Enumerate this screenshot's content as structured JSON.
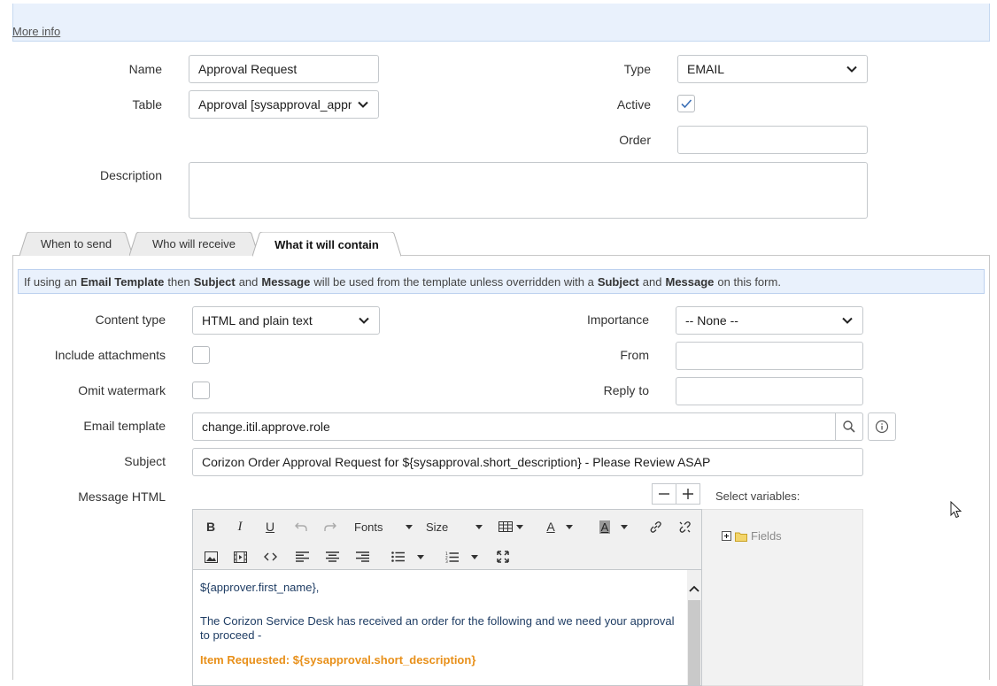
{
  "banner": {
    "more_info": "More info"
  },
  "form": {
    "name": {
      "label": "Name",
      "value": "Approval Request"
    },
    "table": {
      "label": "Table",
      "value": "Approval [sysapproval_approver]"
    },
    "type": {
      "label": "Type",
      "value": "EMAIL"
    },
    "active": {
      "label": "Active",
      "checked": true
    },
    "order": {
      "label": "Order",
      "value": ""
    },
    "description": {
      "label": "Description",
      "value": ""
    }
  },
  "tabs": [
    {
      "label": "When to send"
    },
    {
      "label": "Who will receive"
    },
    {
      "label": "What it will contain",
      "active": true
    }
  ],
  "notice": {
    "p1": "If using an",
    "b1": "Email Template",
    "p2": "then",
    "b2": "Subject",
    "p3": "and",
    "b3": "Message",
    "p4": "will be used from the template unless overridden with a",
    "b4": "Subject",
    "p5": "and",
    "b5": "Message",
    "p6": "on this form."
  },
  "contain": {
    "content_type": {
      "label": "Content type",
      "value": "HTML and plain text"
    },
    "importance": {
      "label": "Importance",
      "value": "-- None --"
    },
    "include_attachments": {
      "label": "Include attachments",
      "checked": false
    },
    "from": {
      "label": "From",
      "value": ""
    },
    "omit_watermark": {
      "label": "Omit watermark",
      "checked": false
    },
    "reply_to": {
      "label": "Reply to",
      "value": ""
    },
    "email_template": {
      "label": "Email template",
      "value": "change.itil.approve.role"
    },
    "subject": {
      "label": "Subject",
      "value": "Corizon Order Approval Request for ${sysapproval.short_description} - Please Review ASAP"
    },
    "message_html": {
      "label": "Message HTML"
    },
    "select_variables": "Select variables:"
  },
  "editor": {
    "toolbar": {
      "fonts": "Fonts",
      "size": "Size"
    },
    "content": {
      "line1": "${approver.first_name},",
      "line2": "The Corizon Service Desk has received an order for the following and we need your approval to proceed -",
      "line3": "Item Requested: ${sysapproval.short_description}"
    }
  },
  "tree": {
    "fields": "Fields"
  },
  "colors": {
    "accent": "#3b6fb6",
    "banner_bg": "#e9f1fc",
    "orange": "#e8901a"
  }
}
